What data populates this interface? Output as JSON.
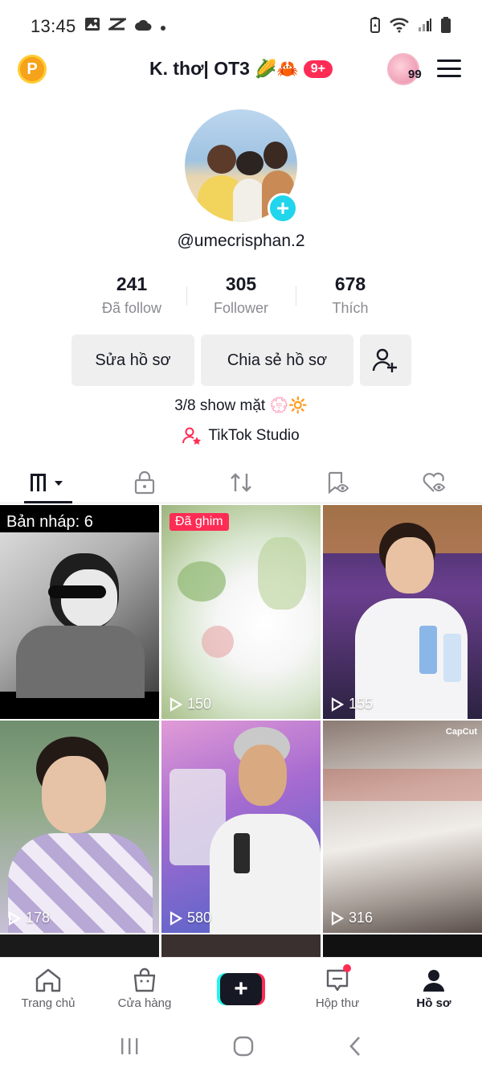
{
  "status_bar": {
    "time": "13:45"
  },
  "header": {
    "title": "K. thơ| OT3",
    "emojis": "🌽🦀",
    "notification_badge": "9+",
    "points_badge": "P",
    "avatar_count": "99"
  },
  "profile": {
    "username": "@umecrisphan.2",
    "stats": [
      {
        "value": "241",
        "label": "Đã follow"
      },
      {
        "value": "305",
        "label": "Follower"
      },
      {
        "value": "678",
        "label": "Thích"
      }
    ],
    "edit_label": "Sửa hồ sơ",
    "share_label": "Chia sẻ hồ sơ",
    "bio": "3/8 show mặt 💮🔆",
    "studio_label": "TikTok Studio"
  },
  "grid": {
    "draft_label": "Bản nháp: 6",
    "pinned_label": "Đã ghim",
    "capcut_label": "CapCut",
    "views": [
      "150",
      "155",
      "178",
      "580",
      "316"
    ]
  },
  "bottom_nav": {
    "home": "Trang chủ",
    "shop": "Cửa hàng",
    "inbox": "Hộp thư",
    "profile": "Hồ sơ"
  },
  "colors": {
    "accent_red": "#fe2c55",
    "accent_cyan": "#25f4ee",
    "text_primary": "#161823",
    "text_secondary": "#8a8b91"
  }
}
